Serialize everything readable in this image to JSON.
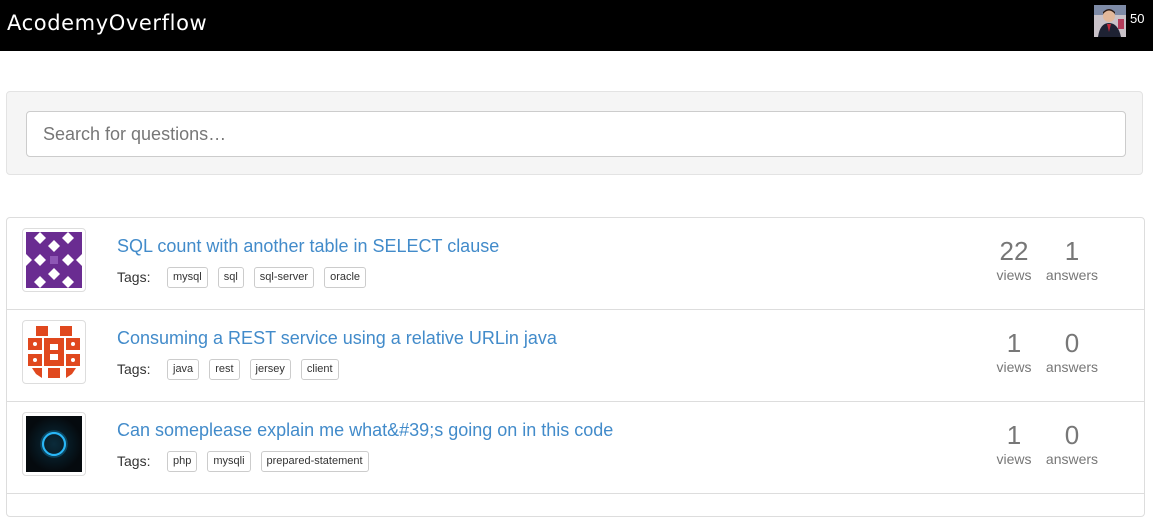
{
  "header": {
    "brand": "AcodemyOverflow",
    "reputation": "50"
  },
  "search": {
    "placeholder": "Search for questions…"
  },
  "labels": {
    "tags": "Tags:",
    "views": "views",
    "answers": "answers"
  },
  "questions": [
    {
      "title": "SQL count with another table in SELECT clause",
      "tags": [
        "mysql",
        "sql",
        "sql-server",
        "oracle"
      ],
      "views": "22",
      "answers": "1",
      "avatar_icon": "purple-identicon"
    },
    {
      "title": "Consuming a REST service using a relative URLin java",
      "tags": [
        "java",
        "rest",
        "jersey",
        "client"
      ],
      "views": "1",
      "answers": "0",
      "avatar_icon": "orange-identicon"
    },
    {
      "title": "Can someplease explain me what&#39;s going on in this code",
      "tags": [
        "php",
        "mysqli",
        "prepared-statement"
      ],
      "views": "1",
      "answers": "0",
      "avatar_icon": "blue-ring-avatar"
    }
  ],
  "colors": {
    "navbar": "#000000",
    "link": "#428bca",
    "identicon_purple": "#6a2c91",
    "identicon_orange": "#e0481e"
  }
}
